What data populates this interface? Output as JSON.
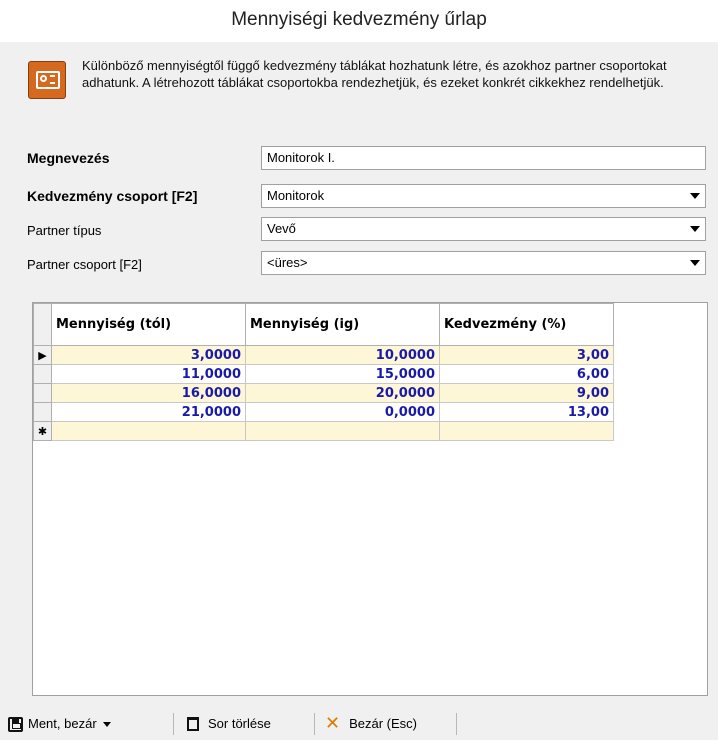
{
  "window": {
    "title": "Mennyiségi kedvezmény űrlap"
  },
  "info": {
    "icon": "safe-icon",
    "text": "Különböző mennyiségtől függő kedvezmény táblákat hozhatunk létre, és azokhoz partner csoportokat adhatunk. A létrehozott táblákat csoportokba rendezhetjük, és ezeket konkrét cikkekhez rendelhetjük."
  },
  "form": {
    "megnevezes": {
      "label": "Megnevezés",
      "value": "Monitorok I."
    },
    "kedvezmeny_csoport": {
      "label": "Kedvezmény csoport [F2]",
      "value": "Monitorok"
    },
    "partner_tipus": {
      "label": "Partner típus",
      "value": "Vevő"
    },
    "partner_csoport": {
      "label": "Partner csoport [F2]",
      "value": "<üres>"
    }
  },
  "grid": {
    "columns": [
      "Mennyiség (tól)",
      "Mennyiség (ig)",
      "Kedvezmény (%)"
    ],
    "rows": [
      [
        "3,0000",
        "10,0000",
        "3,00"
      ],
      [
        "11,0000",
        "15,0000",
        "6,00"
      ],
      [
        "16,0000",
        "20,0000",
        "9,00"
      ],
      [
        "21,0000",
        "0,0000",
        "13,00"
      ]
    ],
    "current_row_marker": "▶",
    "new_row_marker": "✱"
  },
  "toolbar": {
    "save_label": "Ment, bezár",
    "delete_row_label": "Sor törlése",
    "close_label": "Bezár (Esc)"
  },
  "colors": {
    "value_text": "#1a1aa8",
    "row_highlight": "#fdf7d8",
    "icon_orange": "#d4691f"
  }
}
